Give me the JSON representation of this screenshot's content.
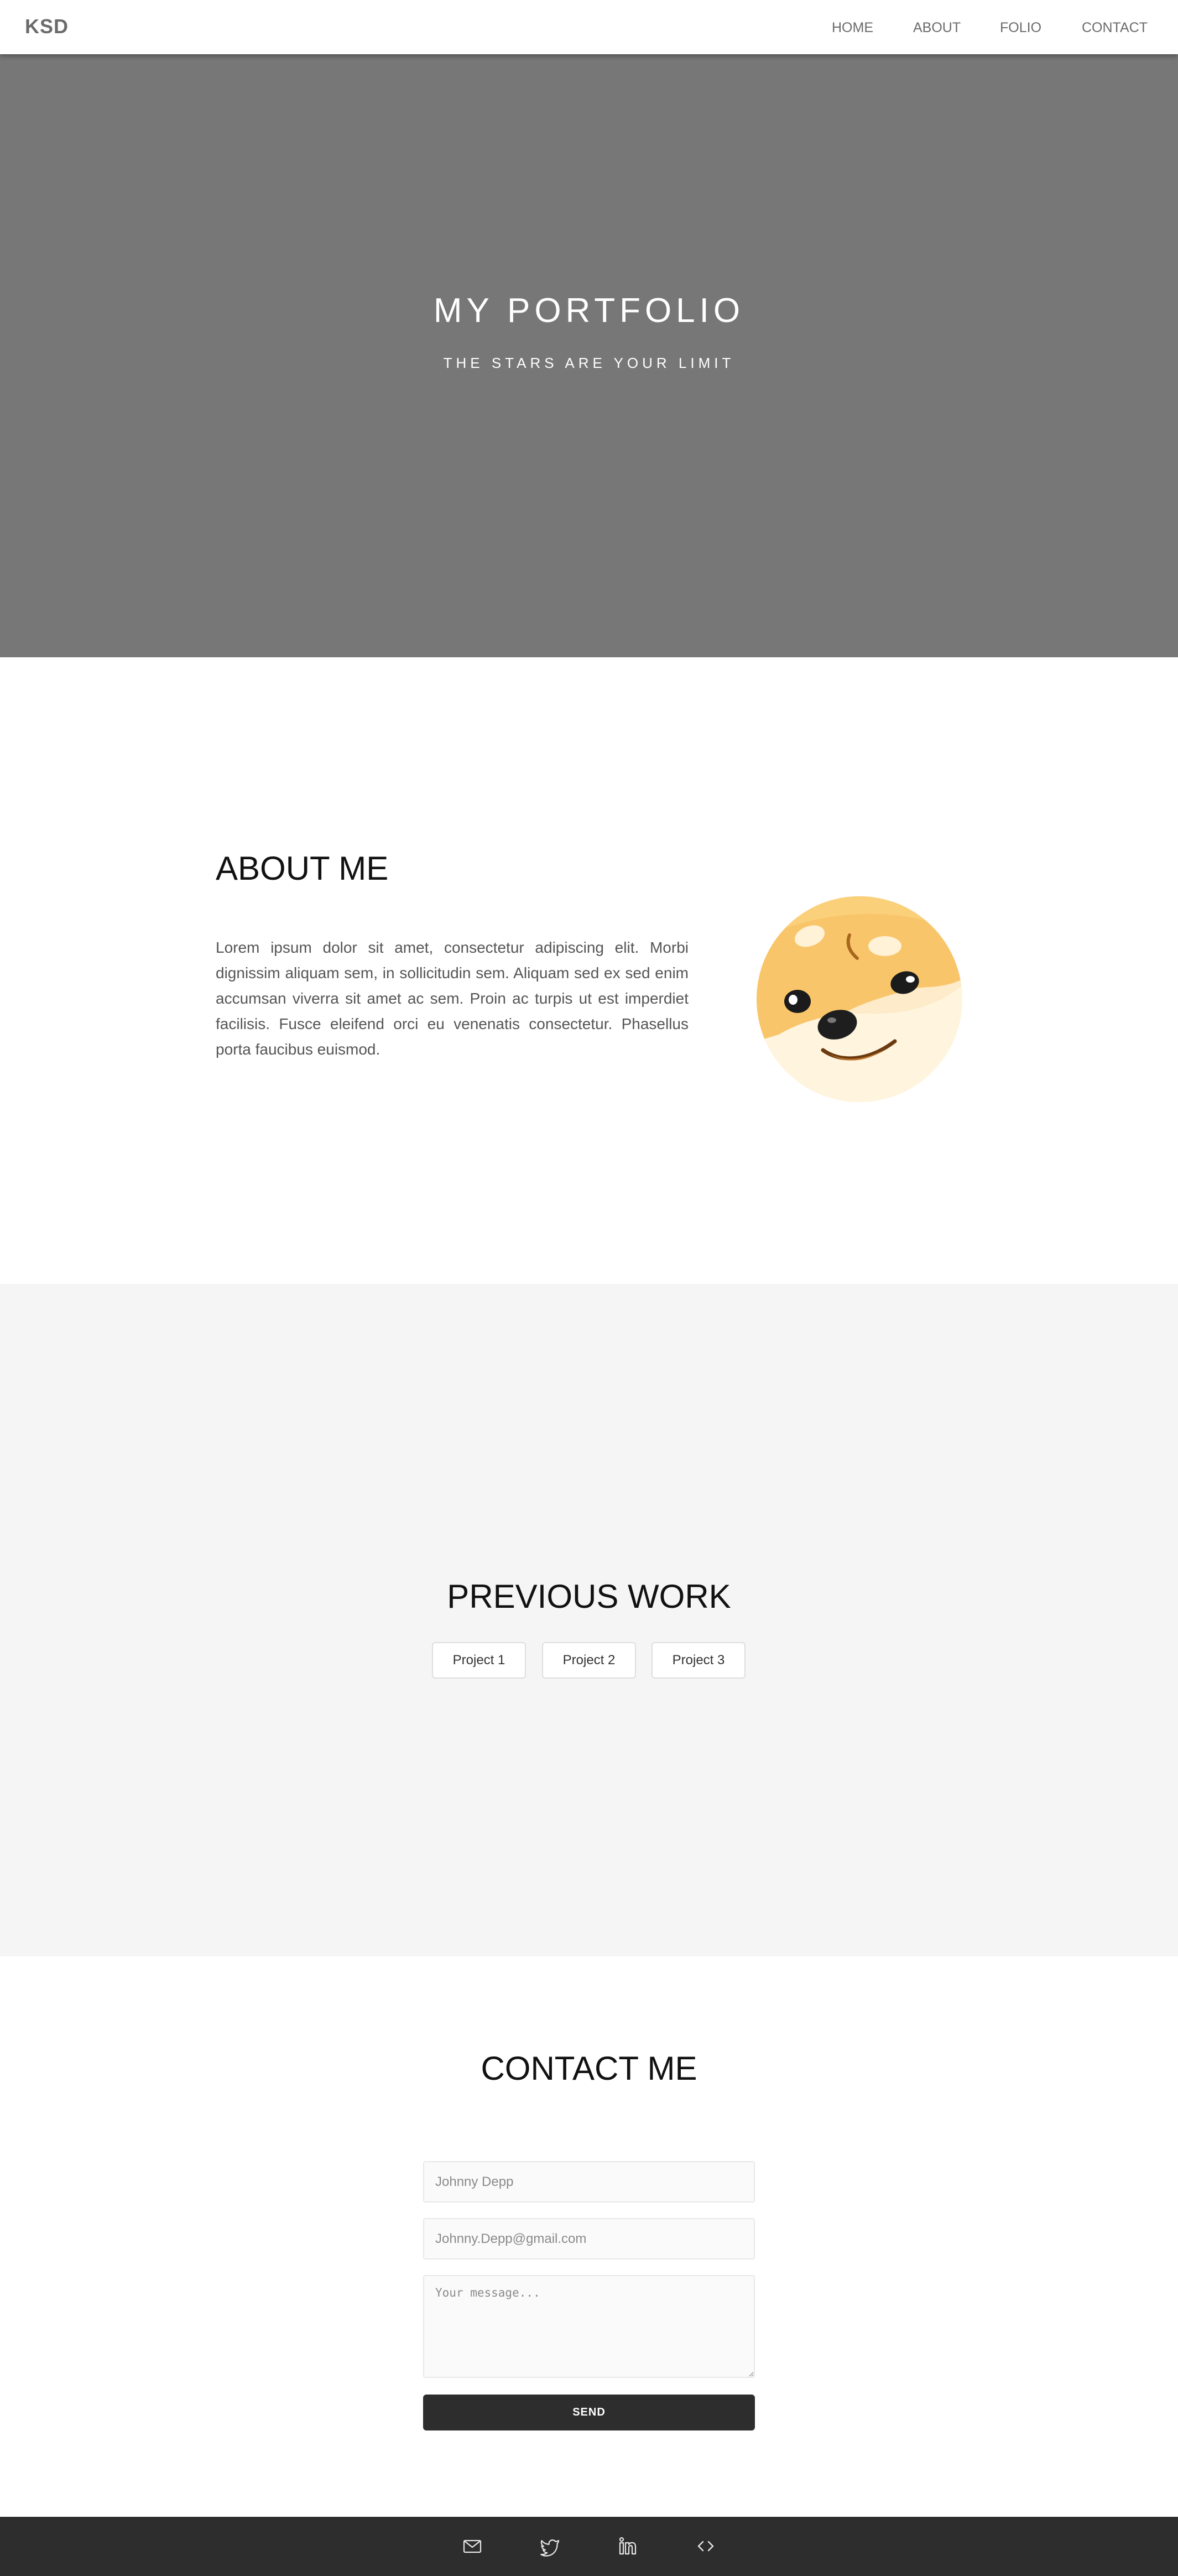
{
  "nav": {
    "brand": "KSD",
    "links": [
      {
        "label": "HOME"
      },
      {
        "label": "ABOUT"
      },
      {
        "label": "FOLIO"
      },
      {
        "label": "CONTACT"
      }
    ]
  },
  "hero": {
    "title": "MY PORTFOLIO",
    "subtitle": "THE STARS ARE YOUR LIMIT",
    "background_color": "#777777"
  },
  "about": {
    "title": "ABOUT ME",
    "text": "Lorem ipsum dolor sit amet, consectetur adipiscing elit. Morbi dignissim aliquam sem, in sollicitudin sem. Aliquam sed ex sed enim accumsan viverra sit amet ac sem. Proin ac turpis ut est imperdiet facilisis. Fusce eleifend orci eu venenatis consectetur. Phasellus porta faucibus euismod.",
    "avatar_icon": "shiba-dog-avatar"
  },
  "work": {
    "title": "PREVIOUS WORK",
    "projects": [
      {
        "label": "Project 1"
      },
      {
        "label": "Project 2"
      },
      {
        "label": "Project 3"
      }
    ]
  },
  "contact": {
    "title": "CONTACT ME",
    "name_placeholder": "Johnny Depp",
    "email_placeholder": "Johnny.Depp@gmail.com",
    "message_placeholder": "Your message...",
    "send_label": "SEND"
  },
  "footer": {
    "icons": [
      "mail-icon",
      "twitter-icon",
      "linkedin-icon",
      "code-icon"
    ],
    "background_color": "#2d2d2d"
  }
}
